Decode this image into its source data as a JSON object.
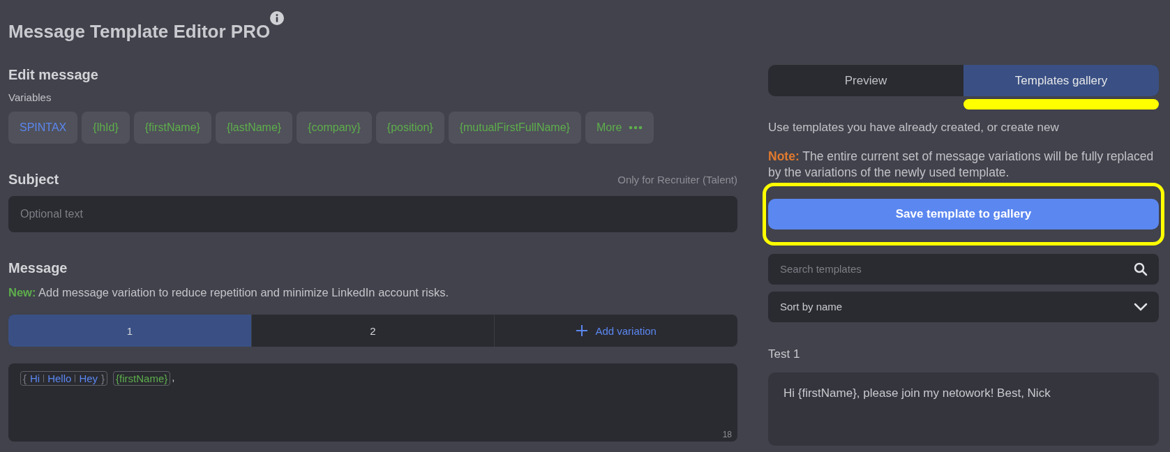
{
  "title": "Message Template Editor PRO",
  "editor": {
    "heading": "Edit message",
    "variables_label": "Variables",
    "variables": [
      {
        "kind": "spintax",
        "label": "SPINTAX"
      },
      {
        "kind": "variable",
        "label": "{lhId}"
      },
      {
        "kind": "variable",
        "label": "{firstName}"
      },
      {
        "kind": "variable",
        "label": "{lastName}"
      },
      {
        "kind": "variable",
        "label": "{company}"
      },
      {
        "kind": "variable",
        "label": "{position}"
      },
      {
        "kind": "variable",
        "label": "{mutualFirstFullName}"
      },
      {
        "kind": "more",
        "label": "More"
      }
    ],
    "subject": {
      "label": "Subject",
      "hint": "Only for Recruiter (Talent)",
      "placeholder": "Optional text"
    },
    "message": {
      "label": "Message",
      "note_label": "New:",
      "note": "Add message variation to reduce repetition and minimize LinkedIn account risks.",
      "variations": [
        {
          "kind": "tab",
          "label": "1",
          "selected": true
        },
        {
          "kind": "tab",
          "label": "2",
          "selected": false
        },
        {
          "kind": "add",
          "label": "Add variation",
          "selected": false
        }
      ],
      "content": [
        {
          "kind": "spintax",
          "open": "{",
          "options": [
            "Hi",
            "Hello",
            "Hey"
          ],
          "close": "}"
        },
        {
          "kind": "variable",
          "text": "{firstName}"
        },
        {
          "kind": "text",
          "text": ","
        }
      ],
      "char_count": "18"
    }
  },
  "side": {
    "tabs": [
      {
        "label": "Preview",
        "selected": false,
        "highlighted": false
      },
      {
        "label": "Templates gallery",
        "selected": true,
        "highlighted": true
      }
    ],
    "intro": "Use templates you have already created, or create new",
    "note_label": "Note:",
    "note": "The entire current set of message variations will be fully replaced by the variations of the newly used template.",
    "save_button": {
      "label": "Save template to gallery",
      "highlighted": true
    },
    "search": {
      "placeholder": "Search templates"
    },
    "sort": {
      "value": "Sort by name"
    },
    "templates": [
      {
        "name": "Test 1",
        "body": "Hi {firstName}, please join my netowork! Best, Nick"
      }
    ]
  }
}
